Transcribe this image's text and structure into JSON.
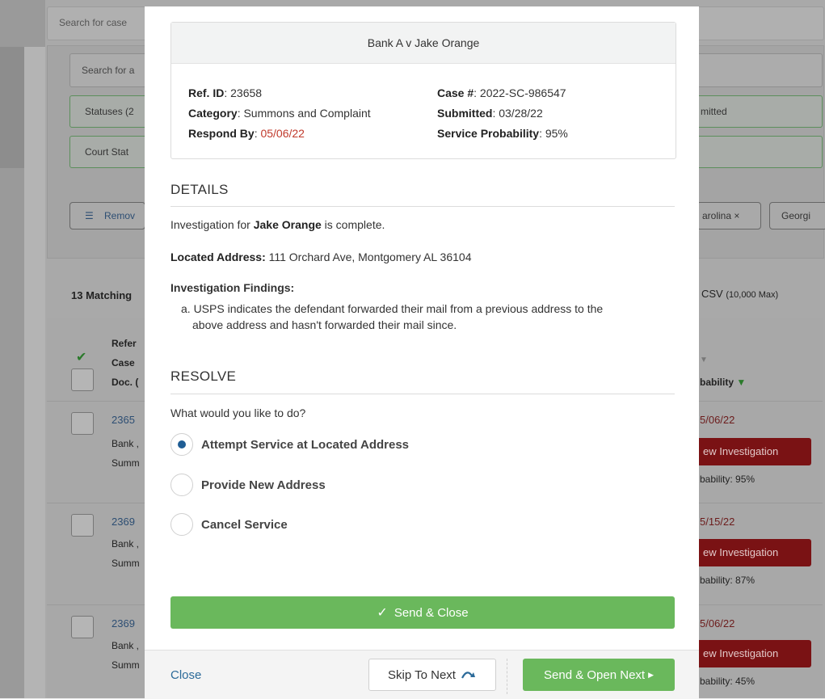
{
  "background": {
    "search_placeholder": "Search for case",
    "panel_search_placeholder": "Search for a",
    "statuses_filter": "Statuses (2",
    "court_state_filter": "Court Stat",
    "submitted_filter": "mitted",
    "remove_button": "Remov",
    "chips": [
      "arolina ×",
      "Georgi"
    ],
    "matching_count": "13 Matching",
    "export_csv": "CSV",
    "export_limit": "(10,000 Max)",
    "table_header": {
      "col1_lines": [
        "Refer",
        "Case",
        "Doc. ("
      ],
      "probability": "bability"
    },
    "rows": [
      {
        "id": "2365",
        "line2": "Bank ,",
        "line3": "Summ",
        "date": "5/06/22",
        "button": "ew Investigation",
        "probability": "bability: 95%"
      },
      {
        "id": "2369",
        "line2": "Bank ,",
        "line3": "Summ",
        "date": "5/15/22",
        "button": "ew Investigation",
        "probability": "bability: 87%"
      },
      {
        "id": "2369",
        "line2": "Bank ,",
        "line3": "Summ",
        "date": "5/06/22",
        "button": "ew Investigation",
        "probability": "bability: 45%"
      }
    ]
  },
  "modal": {
    "case_title": "Bank A v Jake Orange",
    "ref_id_label": "Ref. ID",
    "ref_id": ": 23658",
    "category_label": "Category",
    "category": ": Summons and Complaint",
    "respond_by_label": "Respond By",
    "respond_by": ": ",
    "respond_by_date": "05/06/22",
    "case_no_label": "Case #",
    "case_no": ": 2022-SC-986547",
    "submitted_label": "Submitted",
    "submitted": ": 03/28/22",
    "service_prob_label": "Service Probability",
    "service_prob": ": 95%",
    "details_title": "DETAILS",
    "investigation_pre": "Investigation for ",
    "investigation_name": "Jake Orange",
    "investigation_post": " is complete.",
    "located_label": "Located Address:",
    "located_value": " 111 Orchard Ave, Montgomery AL 36104",
    "findings_label": "Investigation Findings:",
    "finding_a_line1": "a. USPS indicates the defendant forwarded their mail from a previous address to the",
    "finding_a_line2": "above address and hasn't forwarded their mail since.",
    "resolve_title": "RESOLVE",
    "question": "What would you like to do?",
    "options": [
      {
        "label": "Attempt Service at Located Address",
        "selected": true
      },
      {
        "label": "Provide New Address",
        "selected": false
      },
      {
        "label": "Cancel Service",
        "selected": false
      }
    ],
    "send_close": "Send & Close",
    "close_link": "Close",
    "skip_next": "Skip To Next",
    "send_open_next": "Send & Open Next"
  },
  "colors": {
    "green": "#6ab85c",
    "link_blue": "#2b6a99",
    "date_red": "#c0392b",
    "radio_blue": "#1f5d94"
  }
}
